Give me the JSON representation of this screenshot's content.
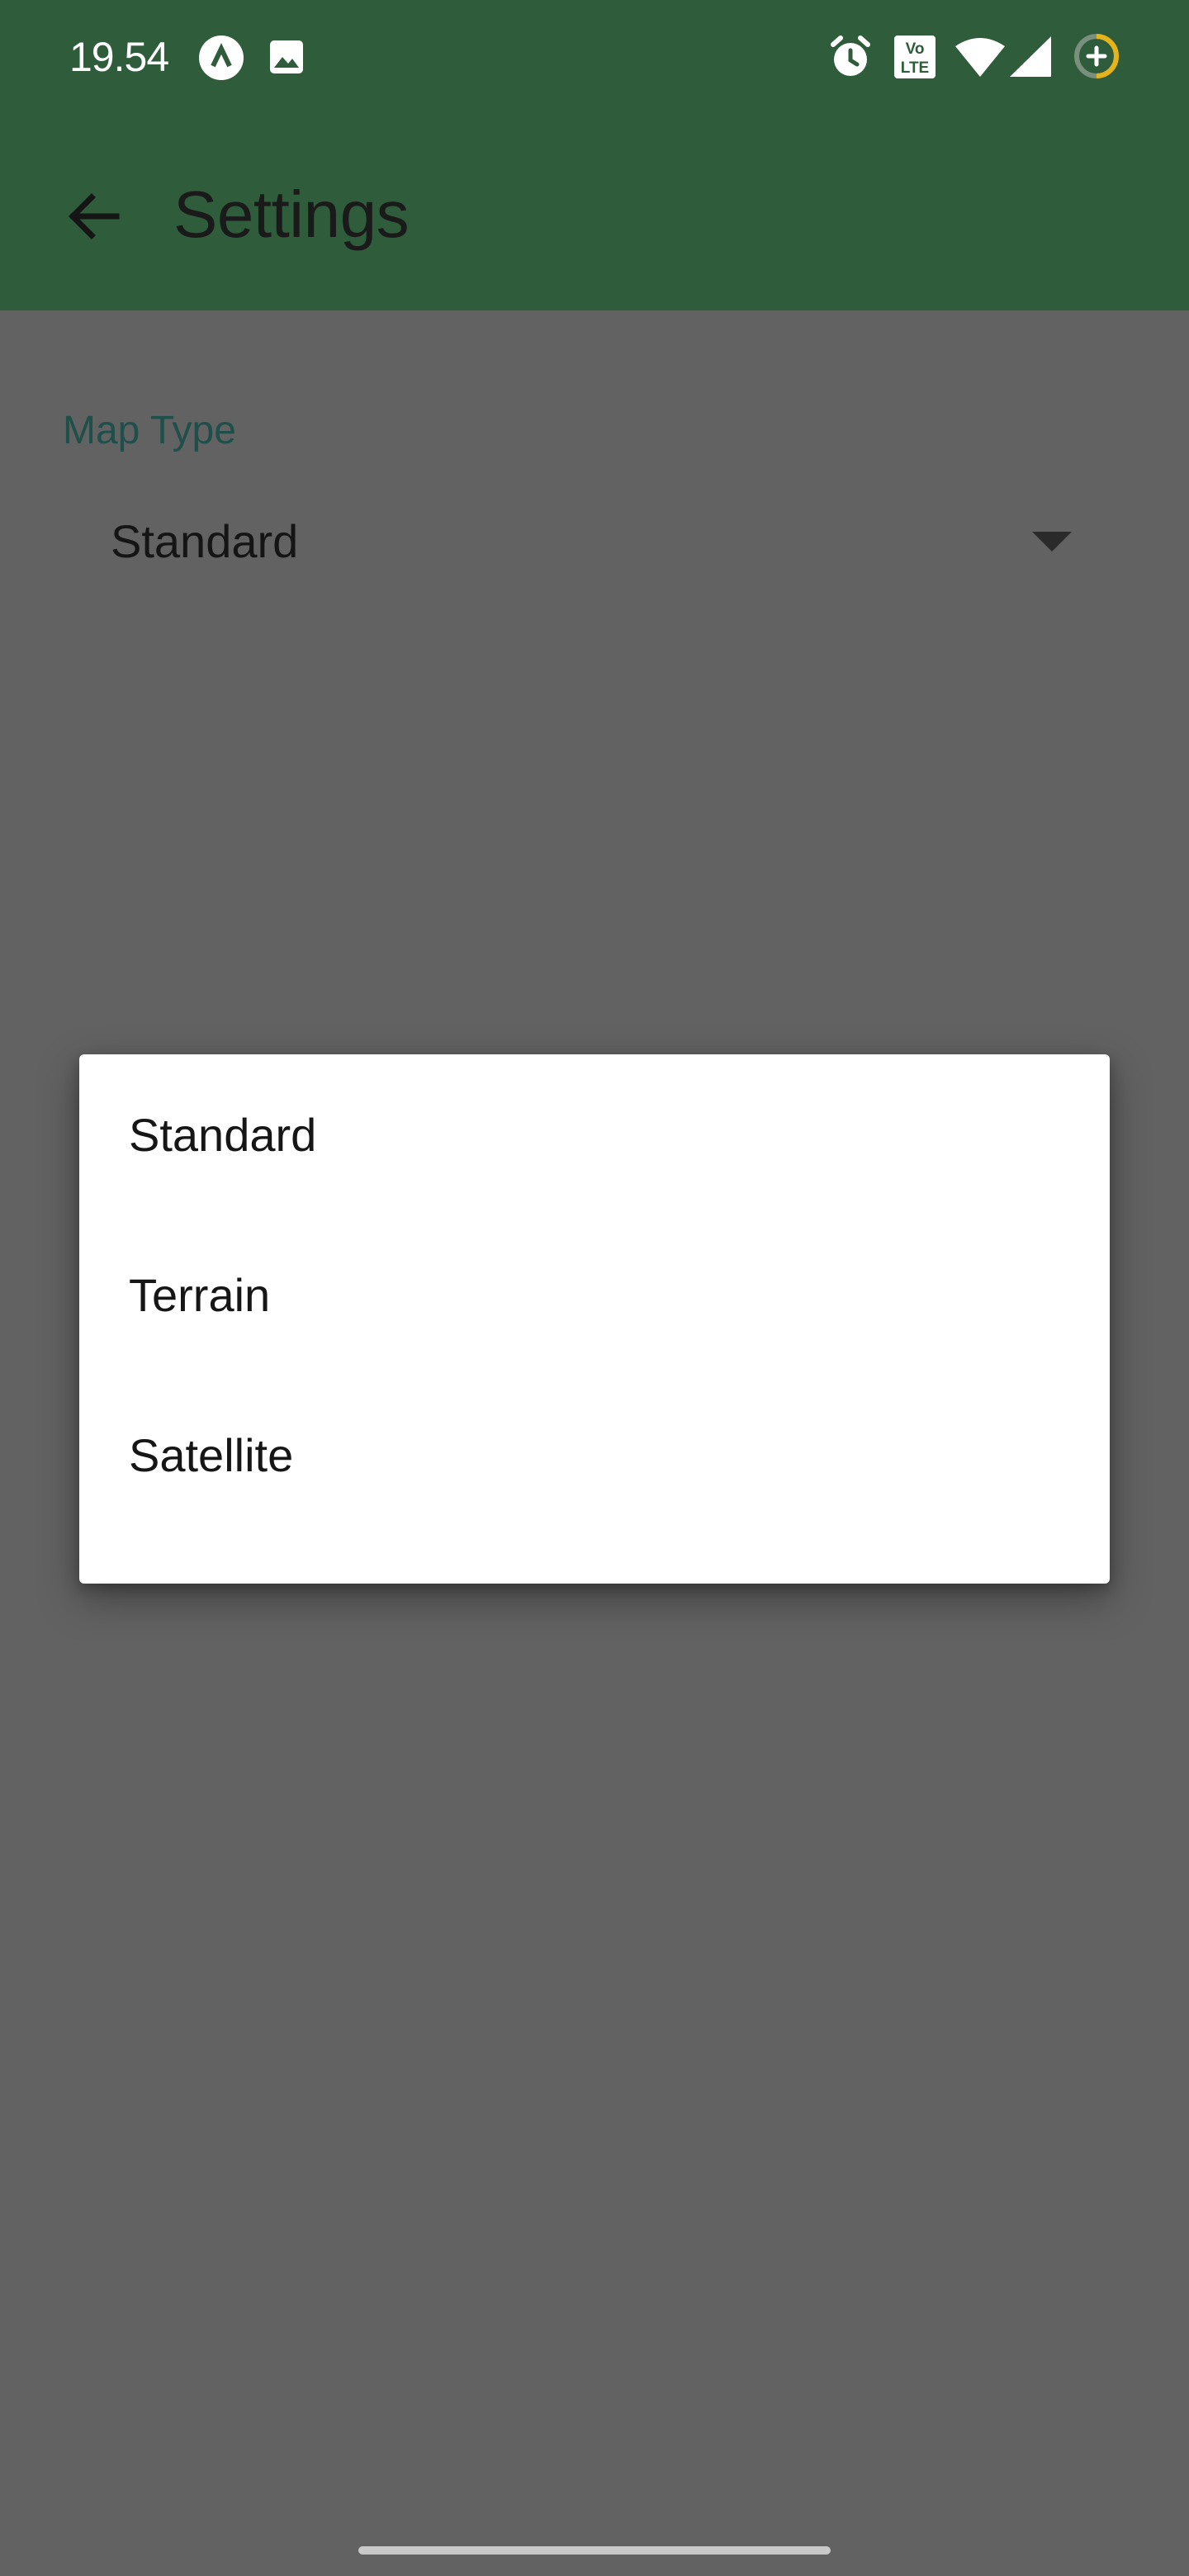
{
  "status_bar": {
    "time": "19.54",
    "left_icons": [
      "app-a-icon",
      "gallery-icon"
    ],
    "right_icons": [
      "alarm-icon",
      "volte-icon",
      "wifi-icon",
      "cell-signal-icon",
      "battery-saver-icon"
    ],
    "volte_text": [
      "Vo",
      "LTE"
    ]
  },
  "toolbar": {
    "title": "Settings",
    "back_icon": "arrow-back-icon",
    "color": "#2f5c3a"
  },
  "settings": {
    "map_type_label": "Map Type",
    "map_type_value": "Standard"
  },
  "menu": {
    "options": [
      {
        "label": "Standard"
      },
      {
        "label": "Terrain"
      },
      {
        "label": "Satellite"
      }
    ]
  },
  "colors": {
    "scrim_background": "#626262",
    "accent_label": "#1f4f4a",
    "menu_background": "#ffffff"
  }
}
